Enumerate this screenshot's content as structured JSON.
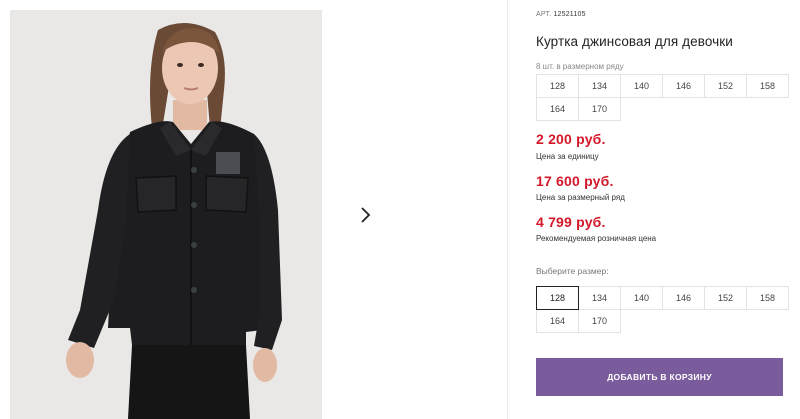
{
  "product": {
    "article_prefix": "АРТ.",
    "article_number": "12521105",
    "title": "Куртка джинсовая для девочки",
    "image_alt": "product-photo-girl-black-denim-jacket"
  },
  "pack": {
    "label": "8 шт. в размерном ряду",
    "sizes": [
      "128",
      "134",
      "140",
      "146",
      "152",
      "158",
      "164",
      "170"
    ]
  },
  "prices": {
    "unit_price": "2 200 руб.",
    "unit_label": "Цена за единицу",
    "pack_price": "17 600 руб.",
    "pack_label": "Цена за размерный ряд",
    "retail_price": "4 799 руб.",
    "retail_label": "Рекомендуемая розничная цена",
    "price_color": "#d3182a"
  },
  "size_select": {
    "label": "Выберите размер:",
    "options": [
      "128",
      "134",
      "140",
      "146",
      "152",
      "158",
      "164",
      "170"
    ],
    "selected": "128"
  },
  "actions": {
    "add_to_cart": "ДОБАВИТЬ В КОРЗИНУ",
    "button_color": "#7a5c9c"
  },
  "gallery": {
    "next_icon": "chevron-right-icon"
  }
}
